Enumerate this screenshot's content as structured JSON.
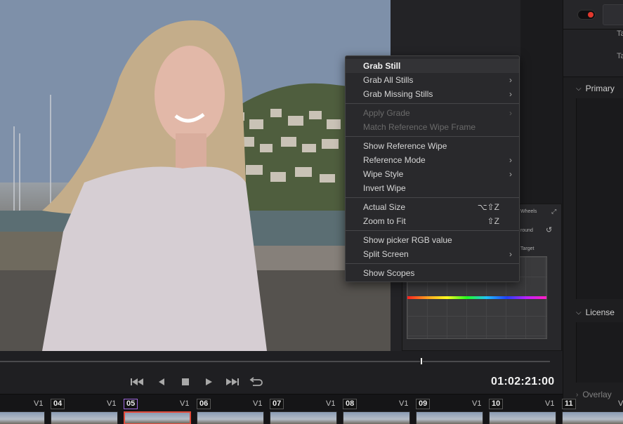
{
  "menu": {
    "items": [
      {
        "label": "Grab Still",
        "highlighted": true
      },
      {
        "label": "Grab All Stills",
        "submenu": true
      },
      {
        "label": "Grab Missing Stills",
        "submenu": true
      },
      {
        "separator": true
      },
      {
        "label": "Apply Grade",
        "submenu": true,
        "disabled": true
      },
      {
        "label": "Match Reference Wipe Frame",
        "disabled": true
      },
      {
        "separator": true
      },
      {
        "label": "Show Reference Wipe"
      },
      {
        "label": "Reference Mode",
        "submenu": true
      },
      {
        "label": "Wipe Style",
        "submenu": true
      },
      {
        "label": "Invert Wipe"
      },
      {
        "separator": true
      },
      {
        "label": "Actual Size",
        "shortcut": "⌥⇧Z"
      },
      {
        "label": "Zoom to Fit",
        "shortcut": "⇧Z"
      },
      {
        "separator": true
      },
      {
        "label": "Show picker RGB value"
      },
      {
        "label": "Split Screen",
        "submenu": true
      },
      {
        "separator": true
      },
      {
        "label": "Show Scopes"
      }
    ]
  },
  "right_panel": {
    "row_label_1": "Ta",
    "row_label_2": "Ta",
    "section_primary": "Primary",
    "section_license": "License",
    "section_overlay": "Overlay"
  },
  "wheel_panel": {
    "label_wheels": "Wheels",
    "label_round": "round",
    "label_target": "Target"
  },
  "transport": {
    "timecode": "01:02:21:00",
    "icons": [
      "skip-to-start-icon",
      "step-back-icon",
      "stop-icon",
      "play-icon",
      "skip-to-end-icon",
      "loop-icon"
    ]
  },
  "clips": [
    {
      "num": "",
      "track": "V1"
    },
    {
      "num": "04",
      "track": "V1"
    },
    {
      "num": "05",
      "track": "V1",
      "active": true
    },
    {
      "num": "06",
      "track": "V1"
    },
    {
      "num": "07",
      "track": "V1"
    },
    {
      "num": "08",
      "track": "V1"
    },
    {
      "num": "09",
      "track": "V1"
    },
    {
      "num": "10",
      "track": "V1"
    },
    {
      "num": "11",
      "track": "V"
    }
  ],
  "colors": {
    "accent_selected_clip": "#e24b3b",
    "active_clip_number": "#a06ae0",
    "toggle_dot": "#e2382d"
  }
}
